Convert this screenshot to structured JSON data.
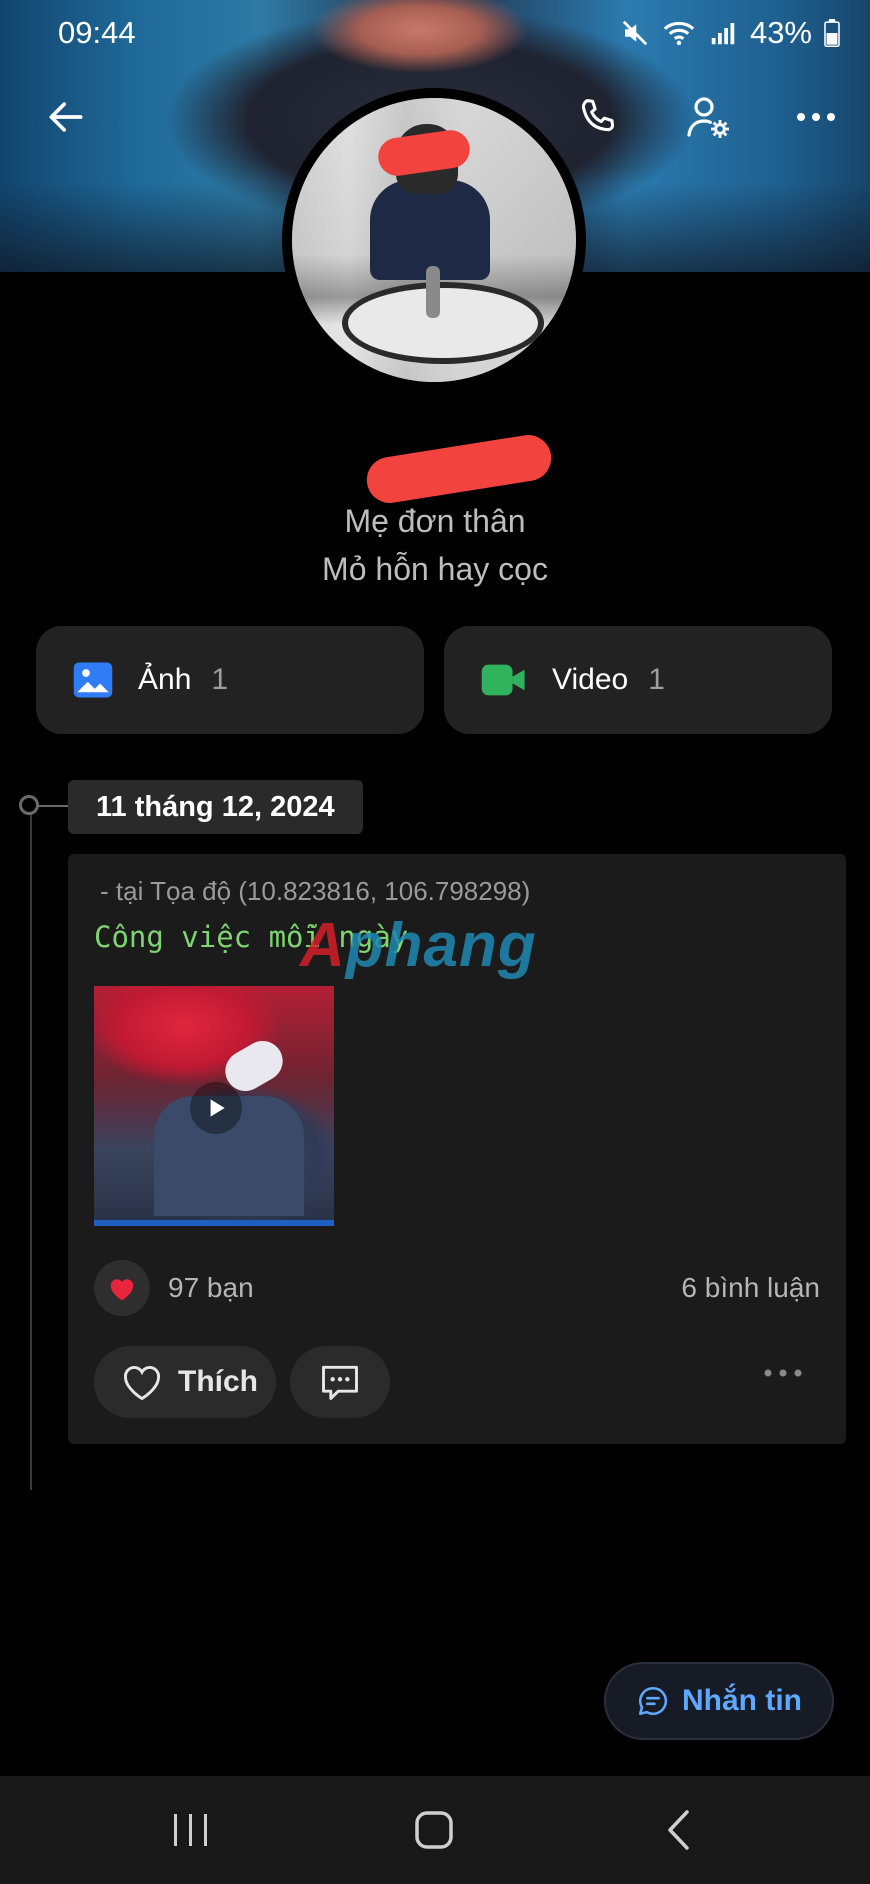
{
  "status_bar": {
    "time": "09:44",
    "battery": "43%"
  },
  "header": {
    "back_icon": "arrow-left-icon",
    "call_icon": "phone-icon",
    "settings_icon": "user-settings-icon",
    "more_icon": "more-horizontal-icon"
  },
  "profile": {
    "bio_line1": "Mẹ đơn thân",
    "bio_line2": "Mỏ hỗn hay cọc"
  },
  "media": {
    "photos": {
      "label": "Ảnh",
      "count": "1",
      "icon": "image-icon",
      "color": "#2f7cf6"
    },
    "videos": {
      "label": "Video",
      "count": "1",
      "icon": "video-camera-icon",
      "color": "#2fb35c"
    }
  },
  "timeline": {
    "date": "11 tháng 12, 2024",
    "post": {
      "location": "- tại Tọa độ (10.823816, 106.798298)",
      "caption": "Công việc mỗi ngày",
      "watermark": "Aphang",
      "reactions": "97 bạn",
      "comments": "6 bình luận",
      "like_label": "Thích"
    }
  },
  "actions": {
    "message_label": "Nhắn tin"
  },
  "colors": {
    "accent": "#5ea8ff",
    "caption_green": "#7ed46f",
    "background": "#000000",
    "card": "#1b1b1b"
  }
}
